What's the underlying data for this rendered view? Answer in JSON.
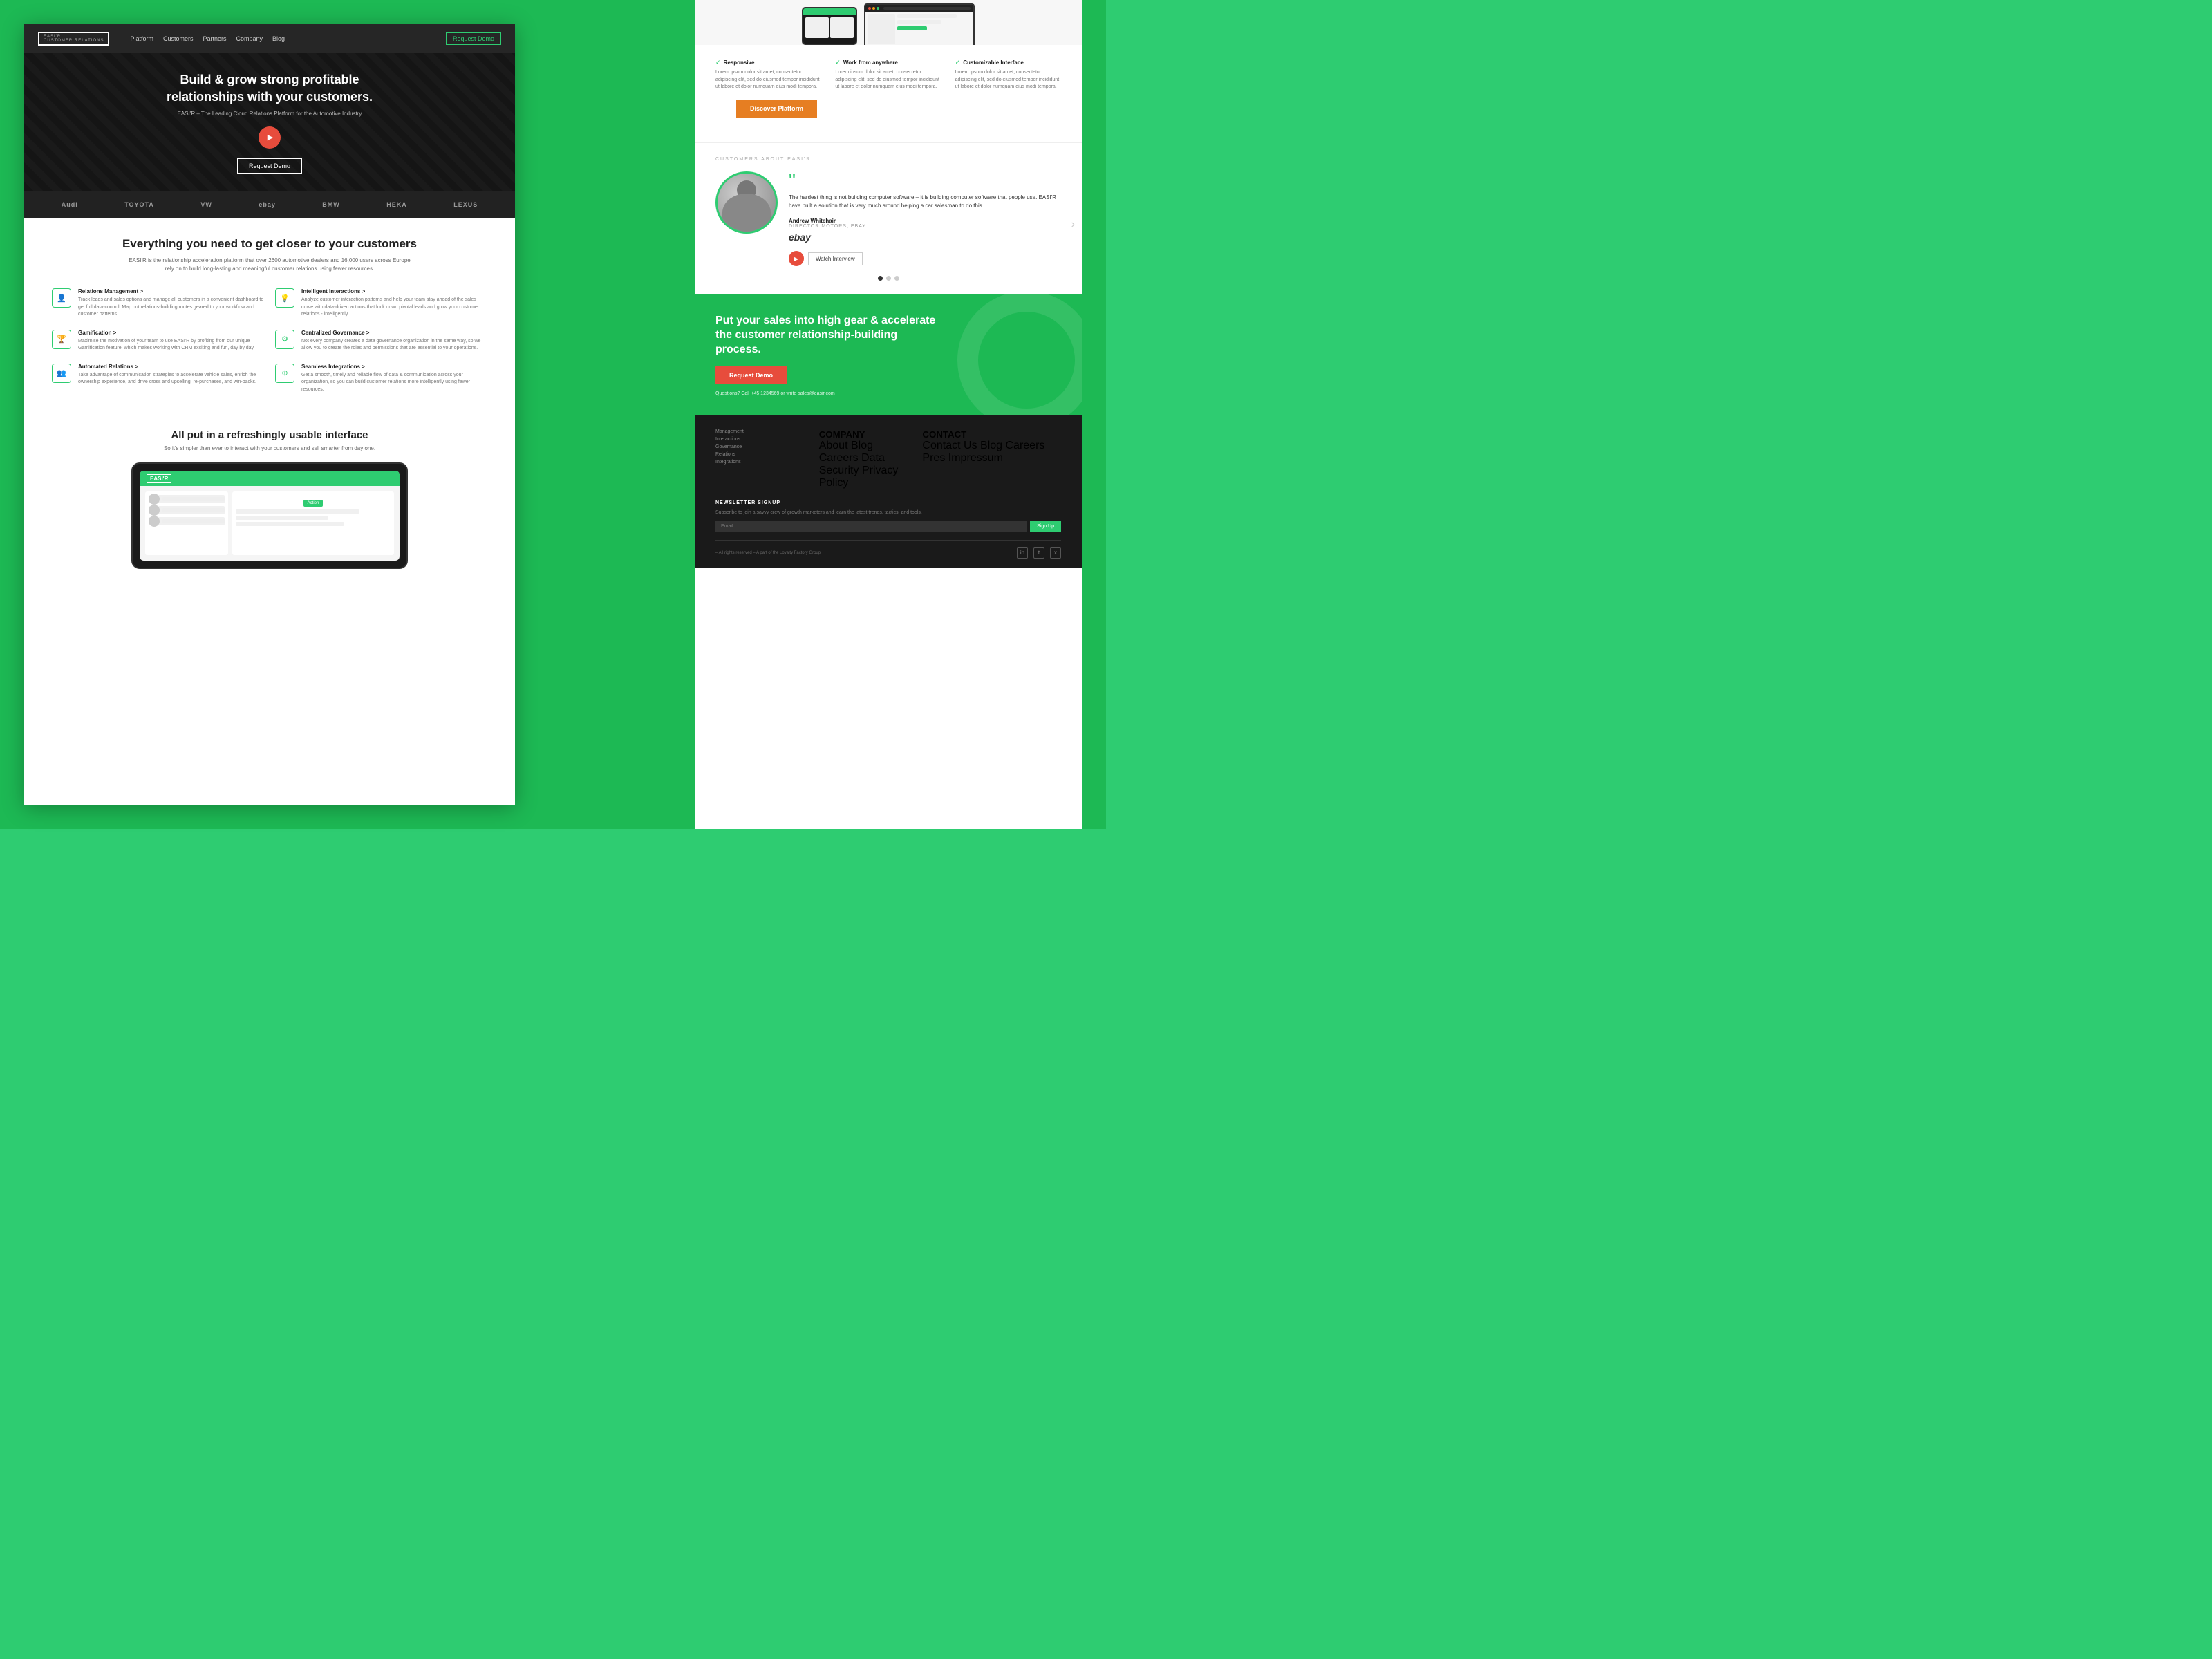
{
  "nav": {
    "logo": "EASI'R",
    "logo_sub": "CUSTOMER RELATIONS",
    "links": [
      "Platform",
      "Customers",
      "Partners",
      "Company",
      "Blog"
    ],
    "cta": "Request Demo"
  },
  "hero": {
    "headline": "Build & grow strong profitable relationships with your customers.",
    "subtitle": "EASI'R – The Leading Cloud Relations Platform for the Automotive Industry",
    "cta": "Request Demo"
  },
  "logos": [
    "Audi",
    "TOYOTA",
    "VW",
    "ebay",
    "BMW",
    "HEKA",
    "LEXUS"
  ],
  "features_section": {
    "title": "Everything you need to get closer to your customers",
    "subtitle": "EASI'R is the relationship acceleration platform that over 2600 automotive dealers and 16,000 users across Europe rely on to build long-lasting and meaningful customer relations using fewer resources.",
    "items": [
      {
        "icon": "👤",
        "title": "Relations Management >",
        "body": "Track leads and sales options and manage all customers in a convenient dashboard to get full data-control. Map out relations-building routes geared to your workflow and customer patterns."
      },
      {
        "icon": "💡",
        "title": "Intelligent Interactions >",
        "body": "Analyze customer interaction patterns and help your team stay ahead of the sales curve with data-driven actions that lock down pivotal leads and grow your customer relations - intelligently."
      },
      {
        "icon": "🏆",
        "title": "Gamification >",
        "body": "Maximise the motivation of your team to use EASI'R by profiting from our unique Gamification feature, which makes working with CRM exciting and fun, day by day."
      },
      {
        "icon": "⚙",
        "title": "Centralized Governance >",
        "body": "Not every company creates a data governance organization in the same way, so we allow you to create the roles and permissions that are essential to your operations."
      },
      {
        "icon": "👥",
        "title": "Automated Relations >",
        "body": "Take advantage of communication strategies to accelerate vehicle sales, enrich the ownership experience, and drive cross and upselling, re-purchases, and win-backs."
      },
      {
        "icon": "⊕",
        "title": "Seamless Integrations >",
        "body": "Get a smooth, timely and reliable flow of data & communication across your organization, so you can build customer relations more intelligently using fewer resources."
      }
    ]
  },
  "usable_section": {
    "title": "All put in a refreshingly usable interface",
    "subtitle": "So it's simpler than ever to interact with your customers and sell smarter from day one."
  },
  "right_panel": {
    "responsive_label": "Responsive",
    "responsive_body": "Lorem ipsum dolor sit amet, consectetur adipiscing elit, sed do eiusmod tempor incididunt ut labore et dolor numquam eius modi tempora.",
    "work_anywhere_label": "Work from anywhere",
    "work_anywhere_body": "Lorem ipsum dolor sit amet, consectetur adipiscing elit, sed do eiusmod tempor incididunt ut labore et dolor numquam eius modi tempora.",
    "customizable_label": "Customizable Interface",
    "customizable_body": "Lorem ipsum dolor sit amet, consectetur adipiscing elit, sed do eiusmod tempor incididunt ut labore et dolor numquam eius modi tempora.",
    "discover_btn": "Discover Platform",
    "testimonial_label": "CUSTOMERS ABOUT EASI'R",
    "quote": "The hardest thing is not building computer software – it is building computer software that people use. EASI'R have built a solution that is very much around helping a car salesman to do this.",
    "author": "Andrew Whitehair",
    "author_role": "DIRECTOR MOTORS, EBAY",
    "watch_label": "Watch Interview",
    "cta_headline": "Put your sales into high gear & accelerate the customer relationship-building process.",
    "cta_btn": "Request Demo",
    "cta_contact": "Questions? Call +45 1234569 or write sales@easir.com",
    "footer": {
      "company_title": "COMPANY",
      "company_links": [
        "About",
        "Blog",
        "Careers",
        "Data Security",
        "Privacy Policy"
      ],
      "contact_title": "CONTACT",
      "contact_links": [
        "Contact Us",
        "Blog",
        "Careers",
        "Pres",
        "Impressum"
      ],
      "newsletter_title": "NEWSLETTER SIGNUP",
      "newsletter_desc": "Subscribe to join a savvy crew of growth marketers and learn the latest trends, tactics, and tools.",
      "newsletter_placeholder": "Email",
      "newsletter_btn": "Sign Up",
      "footer_left_links": [
        "Management",
        "Interactions",
        "Governance",
        "Relations",
        "Integrations"
      ],
      "copyright": "– All rights reserved – A part of the Loyalty Factory Group",
      "social": [
        "in",
        "t",
        "x"
      ]
    }
  }
}
